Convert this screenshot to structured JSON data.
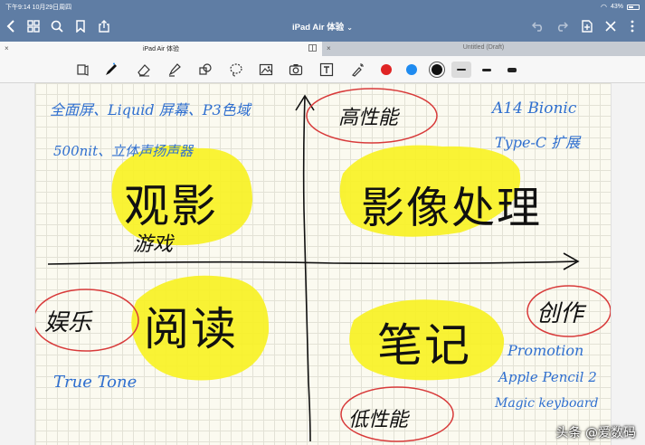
{
  "status_bar": {
    "time": "下午9:14",
    "date": "10月29日周四",
    "battery": "43%"
  },
  "nav": {
    "title": "iPad Air 体验",
    "caret": "⌄"
  },
  "tabs": [
    {
      "label": "iPad Air 体验",
      "active": true
    },
    {
      "label": "Untitled (Draft)",
      "active": false
    }
  ],
  "toolbar": {
    "colors": [
      "#e02424",
      "#1f8bf0",
      "#111111"
    ],
    "selected_color_index": 2,
    "line_widths": [
      "thin",
      "medium",
      "thick"
    ],
    "selected_line_index": 0
  },
  "note": {
    "top_left_line1": "全面屏、Liquid 屏幕、P3色域",
    "top_left_line2": "500nit、立体声扬声器",
    "top_right_line1": "A14 Bionic",
    "top_right_line2": "Type-C 扩展",
    "top_circle": "高性能",
    "q1": "观影",
    "q1_sub": "游戏",
    "q2": "影像处理",
    "left_circle": "娱乐",
    "q3": "阅读",
    "q3_note": "True Tone",
    "q4": "笔记",
    "right_circle": "创作",
    "bottom_right_line1": "Promotion",
    "bottom_right_line2": "Apple Pencil 2",
    "bottom_right_line3": "Magic keyboard",
    "bottom_circle": "低性能"
  },
  "watermark": "头条 @爱数码"
}
